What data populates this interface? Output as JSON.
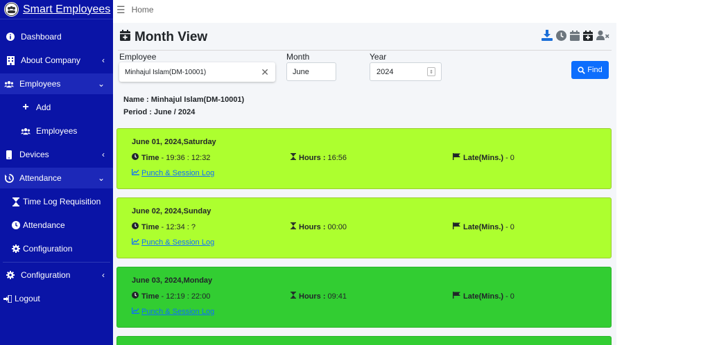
{
  "brand": {
    "title": "Smart Employees"
  },
  "sidebar": {
    "items": [
      {
        "label": "Dashboard"
      },
      {
        "label": "About Company"
      },
      {
        "label": "Employees"
      },
      {
        "label": "Add"
      },
      {
        "label": "Employees"
      },
      {
        "label": "Devices"
      },
      {
        "label": "Attendance"
      },
      {
        "label": "Time Log Requisition"
      },
      {
        "label": "Attendance"
      },
      {
        "label": "Configuration"
      },
      {
        "label": "Configuration"
      },
      {
        "label": "Logout"
      }
    ]
  },
  "topbar": {
    "breadcrumb": "Home"
  },
  "page": {
    "title": "Month View"
  },
  "filters": {
    "employee_label": "Employee",
    "employee_value": "Minhajul Islam(DM-10001)",
    "month_label": "Month",
    "month_value": "June",
    "year_label": "Year",
    "year_value": "2024",
    "find_label": "Find"
  },
  "summary": {
    "name_line": "Name : Minhajul Islam(DM-10001)",
    "period_line": "Period : June / 2024"
  },
  "labels": {
    "time": "Time",
    "hours": "Hours :",
    "late": "Late(Mins.)",
    "log_link": "Punch & Session Log"
  },
  "days": [
    {
      "title": "June 01, 2024,Saturday",
      "time": "- 19:36 : 12:32",
      "hours": "16:56",
      "late": "- 0",
      "status_color": "#adff2f"
    },
    {
      "title": "June 02, 2024,Sunday",
      "time": "- 12:34 : ?",
      "hours": "00:00",
      "late": "- 0",
      "status_color": "#adff2f"
    },
    {
      "title": "June 03, 2024,Monday",
      "time": "- 12:19 : 22:00",
      "hours": "09:41",
      "late": "- 0",
      "status_color": "#32cd32"
    }
  ],
  "colors": {
    "sidebar": "#0a14a6",
    "accent": "#0d6efd"
  },
  "icons": [
    "download-icon",
    "clock-icon",
    "calendar-icon",
    "calendar-plus-icon",
    "user-x-icon"
  ]
}
